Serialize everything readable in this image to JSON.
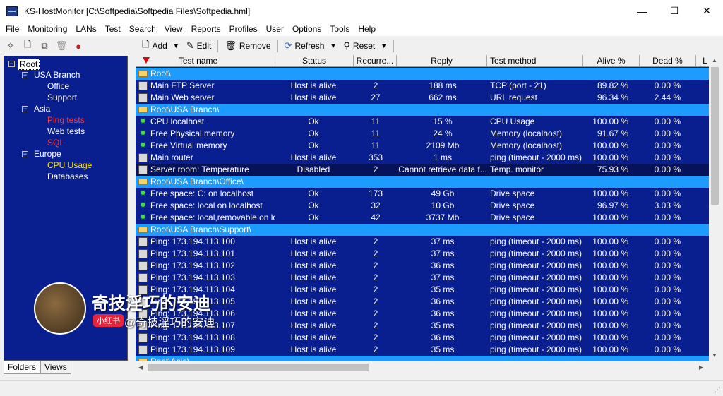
{
  "window": {
    "title": "KS-HostMonitor  [C:\\Softpedia\\Softpedia Files\\Softpedia.hml]"
  },
  "menu": [
    "File",
    "Monitoring",
    "LANs",
    "Test",
    "Search",
    "View",
    "Reports",
    "Profiles",
    "User",
    "Options",
    "Tools",
    "Help"
  ],
  "toolbar": {
    "add": "Add",
    "edit": "Edit",
    "remove": "Remove",
    "refresh": "Refresh",
    "reset": "Reset"
  },
  "tree": {
    "root": "Root",
    "usa_branch": "USA Branch",
    "office": "Office",
    "support": "Support",
    "asia": "Asia",
    "ping_tests": "Ping tests",
    "web_tests": "Web tests",
    "sql": "SQL",
    "europe": "Europe",
    "cpu_usage": "CPU Usage",
    "databases": "Databases"
  },
  "tabs": {
    "folders": "Folders",
    "views": "Views"
  },
  "columns": {
    "test_name": "Test name",
    "status": "Status",
    "recurrence": "Recurre...",
    "reply": "Reply",
    "test_method": "Test method",
    "alive": "Alive %",
    "dead": "Dead %",
    "last": "L"
  },
  "rows": [
    {
      "type": "folder",
      "name": "Root\\"
    },
    {
      "type": "test",
      "icon": "monitor",
      "name": "Main FTP Server",
      "status": "Host is alive",
      "recur": "2",
      "reply": "188 ms",
      "method": "TCP (port - 21)",
      "alive": "89.82 %",
      "dead": "0.00 %"
    },
    {
      "type": "test",
      "icon": "monitor",
      "name": "Main Web server",
      "status": "Host is alive",
      "recur": "27",
      "reply": "662 ms",
      "method": "URL request",
      "alive": "96.34 %",
      "dead": "2.44 %"
    },
    {
      "type": "folder",
      "name": "Root\\USA Branch\\"
    },
    {
      "type": "test",
      "icon": "gear",
      "name": "CPU localhost",
      "status": "Ok",
      "recur": "11",
      "reply": "15 %",
      "method": "CPU Usage",
      "alive": "100.00 %",
      "dead": "0.00 %"
    },
    {
      "type": "test",
      "icon": "gear",
      "name": "Free Physical memory",
      "status": "Ok",
      "recur": "11",
      "reply": "24 %",
      "method": "Memory (localhost)",
      "alive": "91.67 %",
      "dead": "0.00 %"
    },
    {
      "type": "test",
      "icon": "gear",
      "name": "Free Virtual memory",
      "status": "Ok",
      "recur": "11",
      "reply": "2109 Mb",
      "method": "Memory (localhost)",
      "alive": "100.00 %",
      "dead": "0.00 %"
    },
    {
      "type": "test",
      "icon": "monitor",
      "name": "Main router",
      "status": "Host is alive",
      "recur": "353",
      "reply": "1 ms",
      "method": "ping (timeout - 2000 ms)",
      "alive": "100.00 %",
      "dead": "0.00 %"
    },
    {
      "type": "test",
      "icon": "monitor",
      "dark": true,
      "name": "Server room: Temperature",
      "status": "Disabled",
      "recur": "2",
      "reply": "Cannot retrieve data f...",
      "method": "Temp. monitor",
      "alive": "75.93 %",
      "dead": "0.00 %"
    },
    {
      "type": "folder",
      "name": "Root\\USA Branch\\Office\\"
    },
    {
      "type": "test",
      "icon": "gear",
      "name": "Free space: C: on localhost",
      "status": "Ok",
      "recur": "173",
      "reply": "49 Gb",
      "method": "Drive space",
      "alive": "100.00 %",
      "dead": "0.00 %"
    },
    {
      "type": "test",
      "icon": "gear",
      "name": "Free space: local on localhost",
      "status": "Ok",
      "recur": "32",
      "reply": "10 Gb",
      "method": "Drive space",
      "alive": "96.97 %",
      "dead": "3.03 %"
    },
    {
      "type": "test",
      "icon": "gear",
      "name": "Free space: local,removable on loc...",
      "status": "Ok",
      "recur": "42",
      "reply": "3737 Mb",
      "method": "Drive space",
      "alive": "100.00 %",
      "dead": "0.00 %"
    },
    {
      "type": "folder",
      "name": "Root\\USA Branch\\Support\\"
    },
    {
      "type": "test",
      "icon": "monitor",
      "name": "Ping: 173.194.113.100",
      "status": "Host is alive",
      "recur": "2",
      "reply": "37 ms",
      "method": "ping (timeout - 2000 ms)",
      "alive": "100.00 %",
      "dead": "0.00 %"
    },
    {
      "type": "test",
      "icon": "monitor",
      "name": "Ping: 173.194.113.101",
      "status": "Host is alive",
      "recur": "2",
      "reply": "37 ms",
      "method": "ping (timeout - 2000 ms)",
      "alive": "100.00 %",
      "dead": "0.00 %"
    },
    {
      "type": "test",
      "icon": "monitor",
      "name": "Ping: 173.194.113.102",
      "status": "Host is alive",
      "recur": "2",
      "reply": "36 ms",
      "method": "ping (timeout - 2000 ms)",
      "alive": "100.00 %",
      "dead": "0.00 %"
    },
    {
      "type": "test",
      "icon": "monitor",
      "name": "Ping: 173.194.113.103",
      "status": "Host is alive",
      "recur": "2",
      "reply": "37 ms",
      "method": "ping (timeout - 2000 ms)",
      "alive": "100.00 %",
      "dead": "0.00 %"
    },
    {
      "type": "test",
      "icon": "monitor",
      "name": "Ping: 173.194.113.104",
      "status": "Host is alive",
      "recur": "2",
      "reply": "35 ms",
      "method": "ping (timeout - 2000 ms)",
      "alive": "100.00 %",
      "dead": "0.00 %"
    },
    {
      "type": "test",
      "icon": "monitor",
      "name": "Ping: 173.194.113.105",
      "status": "Host is alive",
      "recur": "2",
      "reply": "36 ms",
      "method": "ping (timeout - 2000 ms)",
      "alive": "100.00 %",
      "dead": "0.00 %"
    },
    {
      "type": "test",
      "icon": "monitor",
      "name": "Ping: 173.194.113.106",
      "status": "Host is alive",
      "recur": "2",
      "reply": "36 ms",
      "method": "ping (timeout - 2000 ms)",
      "alive": "100.00 %",
      "dead": "0.00 %"
    },
    {
      "type": "test",
      "icon": "monitor",
      "name": "Ping: 173.194.113.107",
      "status": "Host is alive",
      "recur": "2",
      "reply": "35 ms",
      "method": "ping (timeout - 2000 ms)",
      "alive": "100.00 %",
      "dead": "0.00 %"
    },
    {
      "type": "test",
      "icon": "monitor",
      "name": "Ping: 173.194.113.108",
      "status": "Host is alive",
      "recur": "2",
      "reply": "36 ms",
      "method": "ping (timeout - 2000 ms)",
      "alive": "100.00 %",
      "dead": "0.00 %"
    },
    {
      "type": "test",
      "icon": "monitor",
      "name": "Ping: 173.194.113.109",
      "status": "Host is alive",
      "recur": "2",
      "reply": "35 ms",
      "method": "ping (timeout - 2000 ms)",
      "alive": "100.00 %",
      "dead": "0.00 %"
    },
    {
      "type": "folder",
      "name": "Root\\Asia\\"
    }
  ],
  "overlay": {
    "title": "奇技淫巧的安迪",
    "badge": "小红书",
    "handle": "@奇技淫巧的安迪"
  }
}
